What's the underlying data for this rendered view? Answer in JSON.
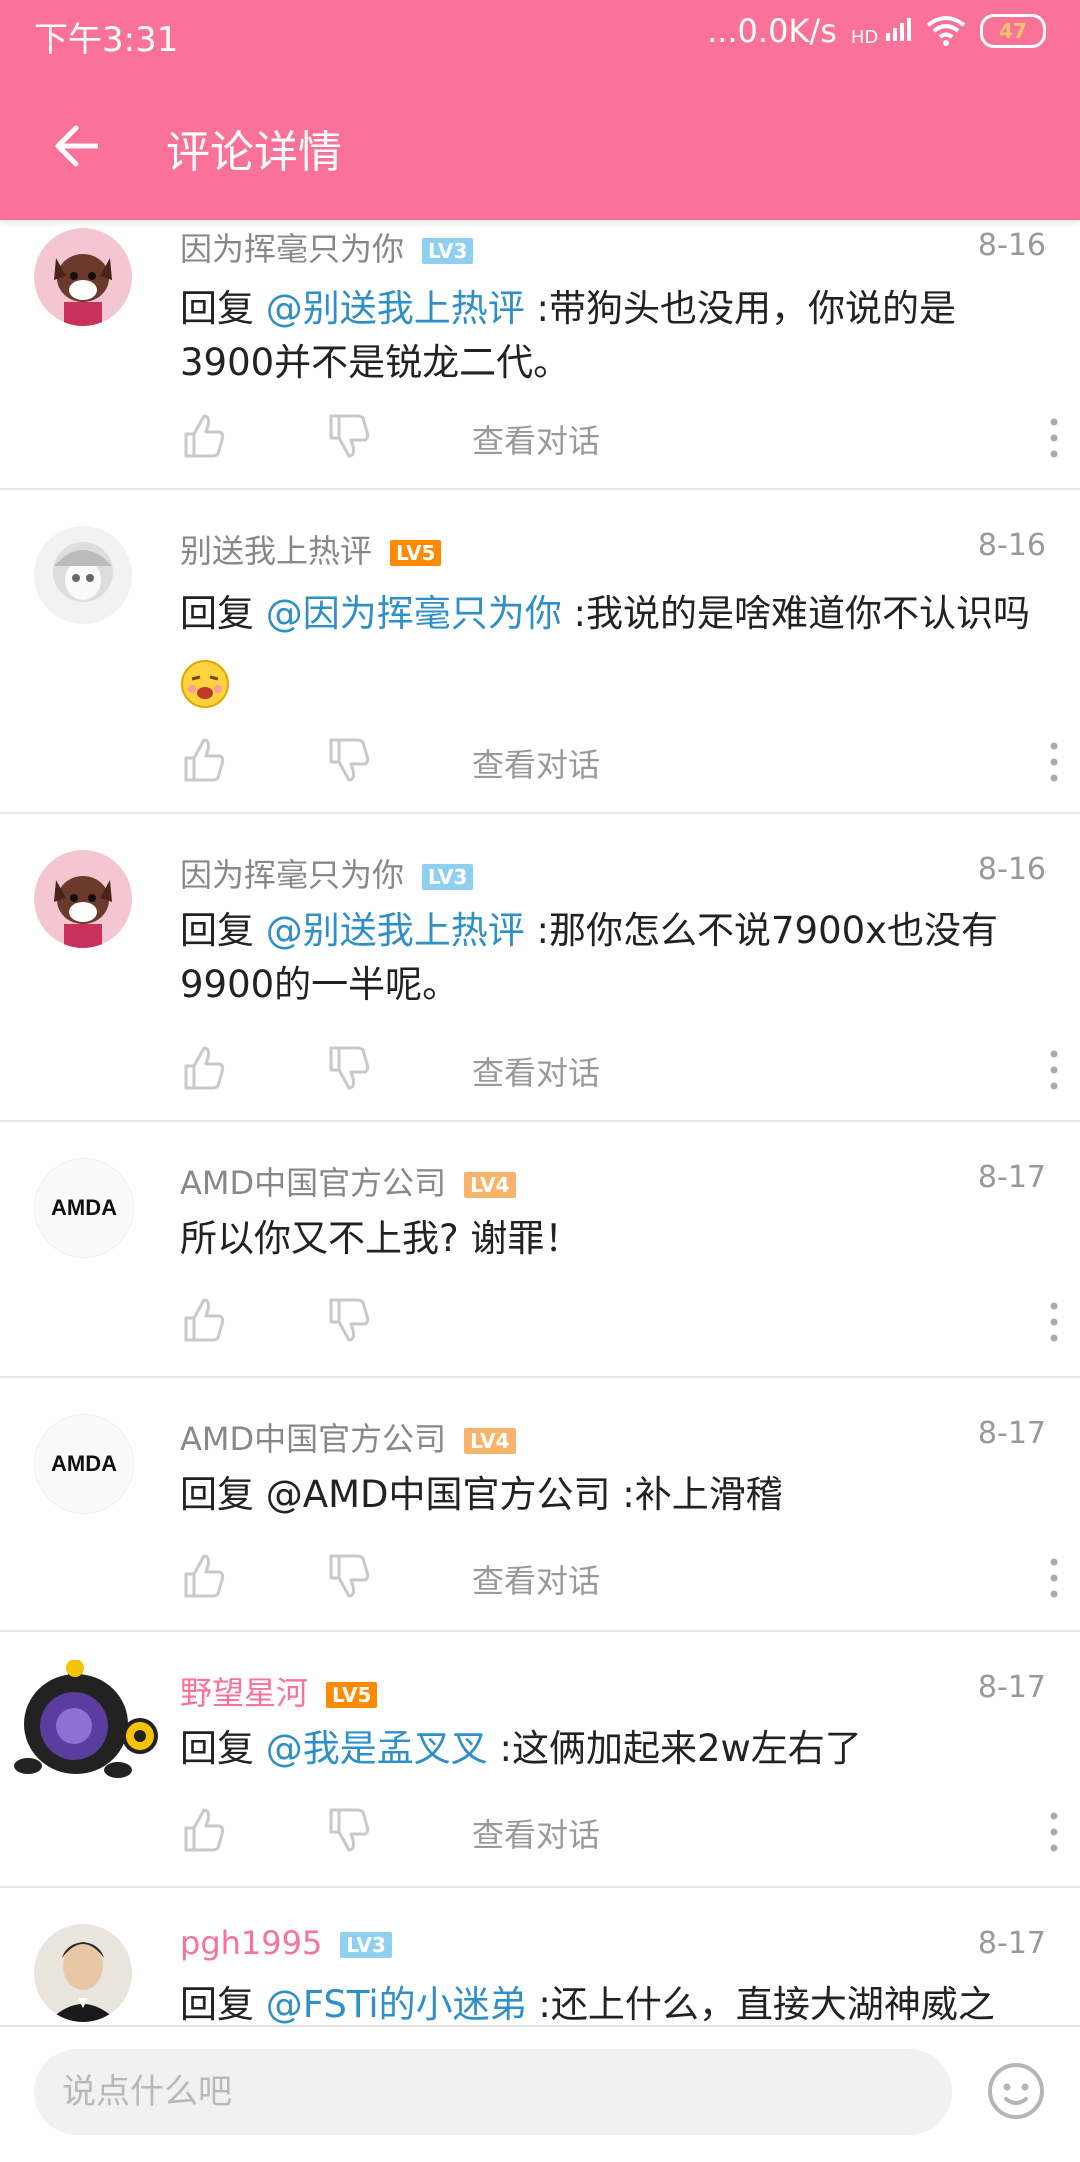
{
  "status": {
    "time": "下午3:31",
    "net": "...0.0K/s",
    "hd": "HD",
    "battery": "47"
  },
  "appbar": {
    "title": "评论详情"
  },
  "comments": [
    {
      "name": "因为挥毫只为你",
      "level": "LV3",
      "date": "8-16",
      "prefix": "回复 ",
      "mention": "@别送我上热评",
      "body": " :带狗头也没用，你说的是3900并不是锐龙二代。",
      "view": "查看对话",
      "avatar": "dog-avatar"
    },
    {
      "name": "别送我上热评",
      "level": "LV5",
      "date": "8-16",
      "prefix": "回复 ",
      "mention": "@因为挥毫只为你",
      "body": " :我说的是啥难道你不认识吗",
      "view": "查看对话",
      "avatar": "anime-avatar"
    },
    {
      "name": "因为挥毫只为你",
      "level": "LV3",
      "date": "8-16",
      "prefix": "回复 ",
      "mention": "@别送我上热评",
      "body": " :那你怎么不说7900x也没有9900的一半呢。",
      "view": "查看对话",
      "avatar": "dog-avatar"
    },
    {
      "name": "AMD中国官方公司",
      "level": "LV4",
      "date": "8-17",
      "prefix": "",
      "mention": "",
      "body": "所以你又不上我? 谢罪！",
      "view": "",
      "avatar": "amd-logo"
    },
    {
      "name": "AMD中国官方公司",
      "level": "LV4",
      "date": "8-17",
      "prefix": "回复 ",
      "mention": "",
      "body": "@AMD中国官方公司 :补上滑稽",
      "view": "查看对话",
      "avatar": "amd-logo"
    },
    {
      "name": "野望星河",
      "level": "LV5",
      "date": "8-17",
      "prefix": "回复 ",
      "mention": "@我是孟叉叉",
      "body": " :这俩加起来2w左右了",
      "view": "查看对话",
      "avatar": "cartoon-avatar"
    },
    {
      "name": "pgh1995",
      "level": "LV3",
      "date": "8-17",
      "prefix": "回复 ",
      "mention": "@FSTi的小迷弟",
      "body": " :还上什么，直接大湖神威之",
      "view": "",
      "avatar": "man-avatar"
    }
  ],
  "amd_logo_text": "AMDA",
  "input": {
    "placeholder": "说点什么吧"
  },
  "colors": {
    "accent": "#fb7299",
    "mention": "#2f8fc9",
    "lv3": "#8fd0f0",
    "lv4": "#f8b46a",
    "lv5": "#ff8a00"
  }
}
